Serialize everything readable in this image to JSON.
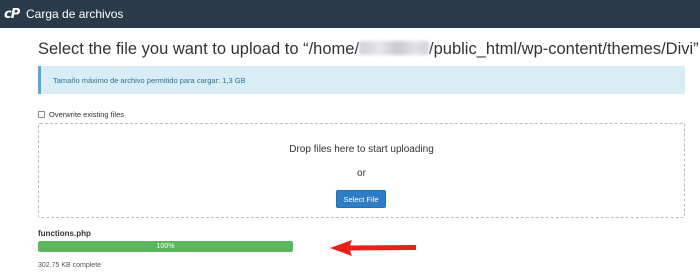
{
  "topbar": {
    "logo": "cP",
    "title": "Carga de archivos"
  },
  "heading": {
    "prefix": "Select the file you want to upload to “/home/",
    "suffix": "/public_html/wp-content/themes/Divi”."
  },
  "info": {
    "max_size_text": "Tamaño máximo de archivo permitido para cargar: 1,3 GB"
  },
  "overwrite": {
    "label": "Overwrite existing files",
    "checked": false
  },
  "dropzone": {
    "drop_text": "Drop files here to start uploading",
    "or_text": "or",
    "select_button": "Select File"
  },
  "upload": {
    "filename": "functions.php",
    "progress": 1.0,
    "progress_label": "100%",
    "size_text": "302.75 KB complete"
  },
  "colors": {
    "topbar": "#293a4a",
    "info_bg": "#d9edf7",
    "button": "#2d7ec6",
    "progress": "#5cb85c",
    "arrow": "#e8211b"
  }
}
